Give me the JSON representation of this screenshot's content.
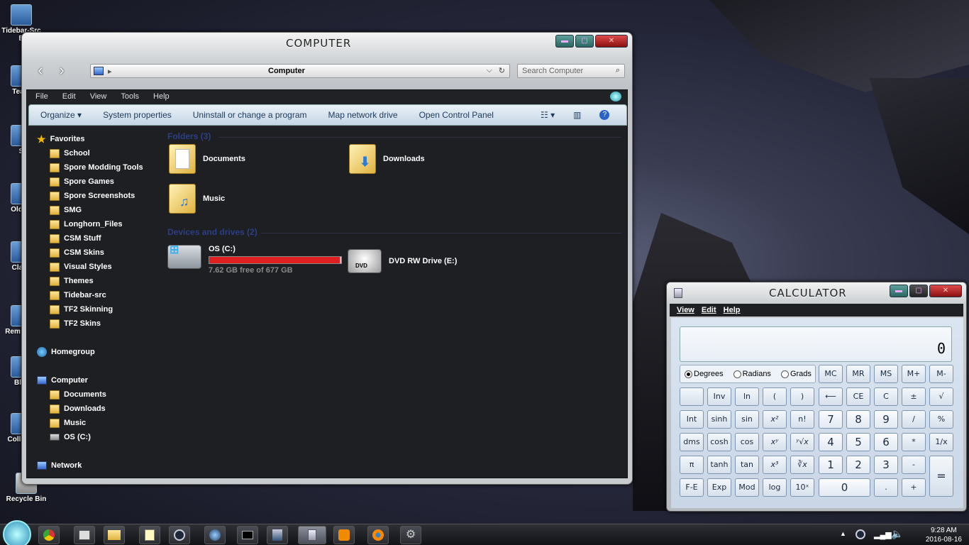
{
  "desktop": {
    "icons": [
      "Tidebar-Src B",
      "Team",
      "S",
      "OldNe",
      "Class",
      "Rem Disk",
      "Blur",
      "Coll Gra",
      "Recycle Bin"
    ]
  },
  "explorer": {
    "title": "COMPUTER",
    "address": "Computer",
    "search_placeholder": "Search Computer",
    "menu": [
      "File",
      "Edit",
      "View",
      "Tools",
      "Help"
    ],
    "commands": [
      "Organize ▾",
      "System properties",
      "Uninstall or change a program",
      "Map network drive",
      "Open Control Panel"
    ],
    "nav": {
      "favorites": "Favorites",
      "favorite_items": [
        "School",
        "Spore Modding Tools",
        "Spore Games",
        "Spore Screenshots",
        "SMG",
        "Longhorn_Files",
        "CSM Stuff",
        "CSM Skins",
        "Visual Styles",
        "Themes",
        "Tidebar-src",
        "TF2 Skinning",
        "TF2 Skins"
      ],
      "homegroup": "Homegroup",
      "computer": "Computer",
      "computer_items": [
        "Documents",
        "Downloads",
        "Music",
        "OS (C:)"
      ],
      "network": "Network"
    },
    "folders_header": "Folders (3)",
    "folders": [
      "Documents",
      "Downloads",
      "Music"
    ],
    "devices_header": "Devices and drives (2)",
    "drive_c": {
      "name": "OS (C:)",
      "free": "7.62 GB free of 677 GB",
      "used_fraction": 0.989
    },
    "drive_e": {
      "name": "DVD RW Drive (E:)",
      "badge": "DVD"
    }
  },
  "calculator": {
    "title": "CALCULATOR",
    "menu": [
      "View",
      "Edit",
      "Help"
    ],
    "display": "0",
    "angle": {
      "degrees": "Degrees",
      "radians": "Radians",
      "grads": "Grads",
      "selected": "Degrees"
    },
    "keys": {
      "mc": "MC",
      "mr": "MR",
      "ms": "MS",
      "mplus": "M+",
      "mminus": "M-",
      "inv": "Inv",
      "ln": "ln",
      "lp": "(",
      "rp": ")",
      "back": "⟵",
      "ce": "CE",
      "c": "C",
      "pm": "±",
      "sqrt": "√",
      "int": "Int",
      "sinh": "sinh",
      "sin": "sin",
      "x2": "x²",
      "nfact": "n!",
      "n7": "7",
      "n8": "8",
      "n9": "9",
      "div": "/",
      "pct": "%",
      "dms": "dms",
      "cosh": "cosh",
      "cos": "cos",
      "xy": "xʸ",
      "yroot": "ʸ√x",
      "n4": "4",
      "n5": "5",
      "n6": "6",
      "mul": "*",
      "inv1x": "1/x",
      "pi": "π",
      "tanh": "tanh",
      "tan": "tan",
      "x3": "x³",
      "cuberoot": "∛x",
      "n1": "1",
      "n2": "2",
      "n3": "3",
      "sub": "-",
      "eq": "=",
      "fe": "F-E",
      "exp": "Exp",
      "mod": "Mod",
      "log": "log",
      "tenx": "10ˣ",
      "n0": "0",
      "dot": ".",
      "add": "+"
    }
  },
  "taskbar": {
    "time": "9:28 AM",
    "date": "2016-08-16"
  }
}
